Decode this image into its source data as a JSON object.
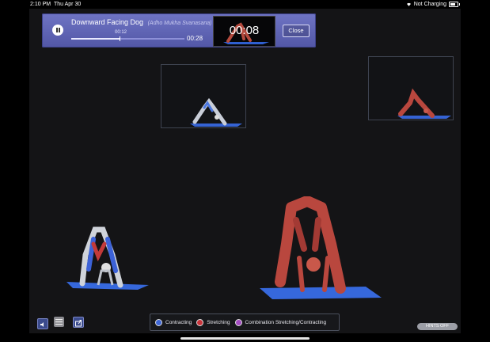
{
  "status_bar": {
    "time": "2:10 PM",
    "date": "Thu Apr 30",
    "battery": "Not Charging"
  },
  "player": {
    "title": "Downward Facing Dog",
    "subtitle": "(Adho Mukha Svanasana)",
    "elapsed": "00:12",
    "duration": "00:28",
    "progress": 0.43,
    "countdown": "00:08",
    "close_label": "Close"
  },
  "legend": [
    {
      "label": "Contracting",
      "color": "#3e66d6"
    },
    {
      "label": "Stretching",
      "color": "#c8343b"
    },
    {
      "label": "Combination Stretching/Contracting",
      "color": "#a34cc2"
    }
  ],
  "hints_label": "HINTS OFF",
  "colors": {
    "accent": "#5a5fb0",
    "mat": "#3a6ad8",
    "muscle": "#b8403a"
  }
}
